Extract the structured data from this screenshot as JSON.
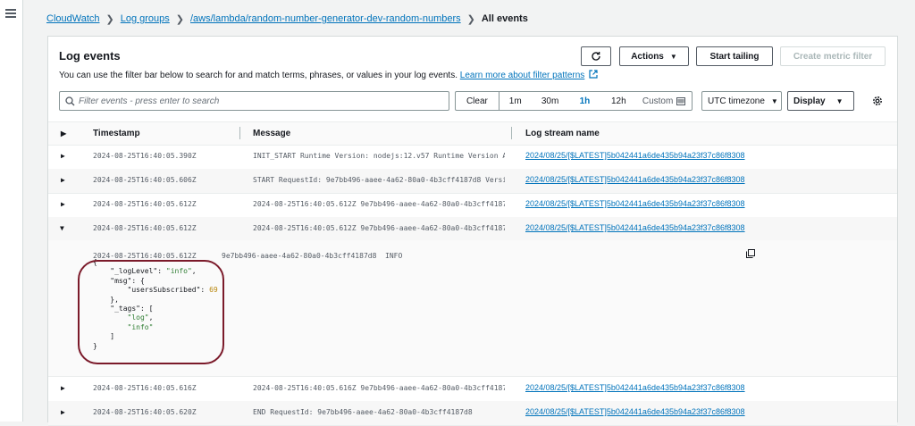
{
  "breadcrumb": {
    "items": [
      "CloudWatch",
      "Log groups",
      "/aws/lambda/random-number-generator-dev-random-numbers"
    ],
    "current": "All events"
  },
  "panel": {
    "title": "Log events",
    "description": "You can use the filter bar below to search for and match terms, phrases, or values in your log events.",
    "learn_more": "Learn more about filter patterns"
  },
  "toolbar": {
    "actions": "Actions",
    "start_tailing": "Start tailing",
    "create_metric_filter": "Create metric filter"
  },
  "filter": {
    "placeholder": "Filter events - press enter to search",
    "clear": "Clear",
    "ranges": [
      "1m",
      "30m",
      "1h",
      "12h"
    ],
    "active_range": "1h",
    "custom": "Custom",
    "timezone": "UTC timezone",
    "display": "Display"
  },
  "table": {
    "headers": [
      "Timestamp",
      "Message",
      "Log stream name"
    ],
    "rows": [
      {
        "timestamp": "2024-08-25T16:40:05.390Z",
        "message": "INIT_START Runtime Version: nodejs:12.v57 Runtime Version AR…",
        "stream": "2024/08/25/[$LATEST]5b042441a6de435b94a23f37c86f8308"
      },
      {
        "timestamp": "2024-08-25T16:40:05.606Z",
        "message": "START RequestId: 9e7bb496-aaee-4a62-80a0-4b3cff4187d8 Versio…",
        "stream": "2024/08/25/[$LATEST]5b042441a6de435b94a23f37c86f8308"
      },
      {
        "timestamp": "2024-08-25T16:40:05.612Z",
        "message": "2024-08-25T16:40:05.612Z 9e7bb496-aaee-4a62-80a0-4b3cff4187d…",
        "stream": "2024/08/25/[$LATEST]5b042441a6de435b94a23f37c86f8308"
      },
      {
        "timestamp": "2024-08-25T16:40:05.612Z",
        "message": "2024-08-25T16:40:05.612Z 9e7bb496-aaee-4a62-80a0-4b3cff4187d…",
        "stream": "2024/08/25/[$LATEST]5b042441a6de435b94a23f37c86f8308"
      },
      {
        "timestamp": "2024-08-25T16:40:05.616Z",
        "message": "2024-08-25T16:40:05.616Z 9e7bb496-aaee-4a62-80a0-4b3cff4187d…",
        "stream": "2024/08/25/[$LATEST]5b042441a6de435b94a23f37c86f8308"
      },
      {
        "timestamp": "2024-08-25T16:40:05.620Z",
        "message": "END RequestId: 9e7bb496-aaee-4a62-80a0-4b3cff4187d8",
        "stream": "2024/08/25/[$LATEST]5b042441a6de435b94a23f37c86f8308"
      }
    ]
  },
  "expanded": {
    "timestamp": "2024-08-25T16:40:05.612Z",
    "request_id": "9e7bb496-aaee-4a62-80a0-4b3cff4187d8",
    "level": "INFO",
    "json_lines": [
      "{",
      "    \"_logLevel\": \"info\",",
      "    \"msg\": {",
      "        \"usersSubscribed\": 69",
      "    },",
      "    \"_tags\": [",
      "        \"log\",",
      "        \"info\"",
      "    ]",
      "}"
    ]
  },
  "colors": {
    "link": "#0073bb",
    "highlight_circle": "#7b1a2a",
    "json_string": "#2e7d32",
    "json_number": "#b8860b"
  }
}
